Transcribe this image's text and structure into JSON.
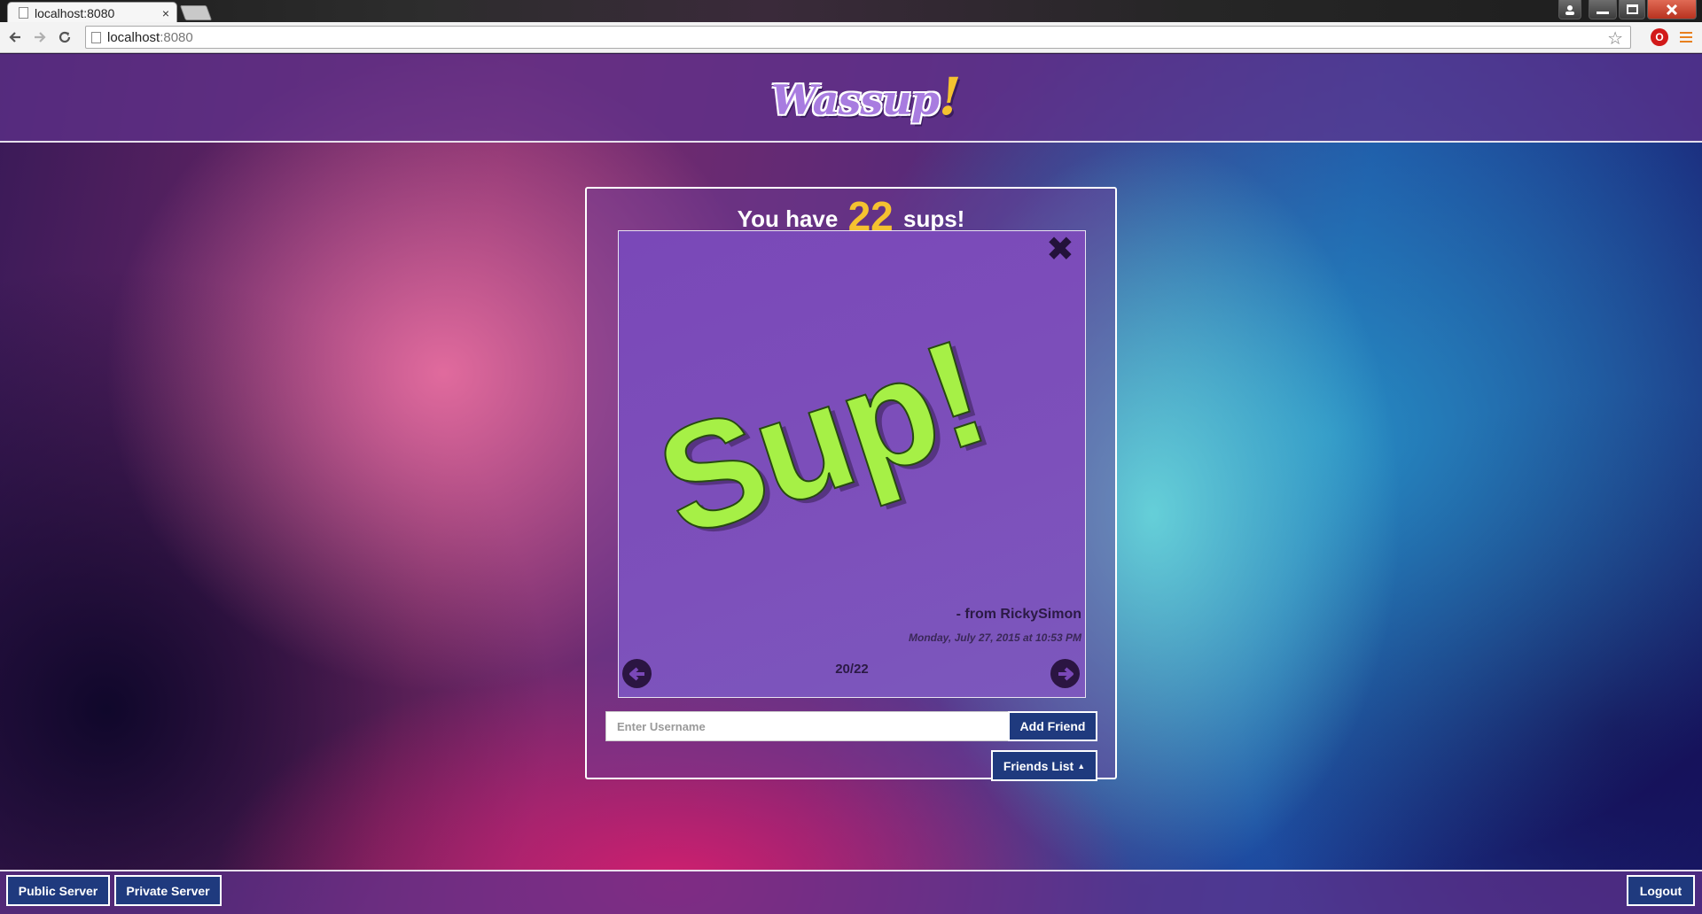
{
  "browser": {
    "tab_title": "localhost:8080",
    "tab_close": "×",
    "url_host": "localhost",
    "url_port": ":8080"
  },
  "app": {
    "logo_text": "Wassup",
    "logo_bang": "!",
    "header_prefix": "You have",
    "sup_count": "22",
    "header_suffix": "sups!"
  },
  "viewer": {
    "message": "Sup!",
    "from": "- from RickySimon",
    "date": "Monday, July 27, 2015 at 10:53 PM",
    "position": "20/22",
    "close_glyph": "✖",
    "prev_glyph": "⬅",
    "next_glyph": "➡"
  },
  "add_friend": {
    "placeholder": "Enter Username",
    "button_label": "Add Friend"
  },
  "friends_list": {
    "label": "Friends List",
    "caret": "▲"
  },
  "footer": {
    "public_server": "Public Server",
    "private_server": "Private Server",
    "logout": "Logout"
  },
  "colors": {
    "accent_yellow": "#f5c230",
    "sup_green": "#a6f046",
    "button_navy": "#1f3a7e",
    "card_purple": "#7a48b8"
  },
  "icons": [
    "page-icon",
    "close-icon",
    "back-arrow-icon",
    "forward-arrow-icon",
    "reload-icon",
    "star-icon",
    "opera-extension-icon",
    "menu-icon",
    "prev-arrow-icon",
    "next-arrow-icon"
  ]
}
